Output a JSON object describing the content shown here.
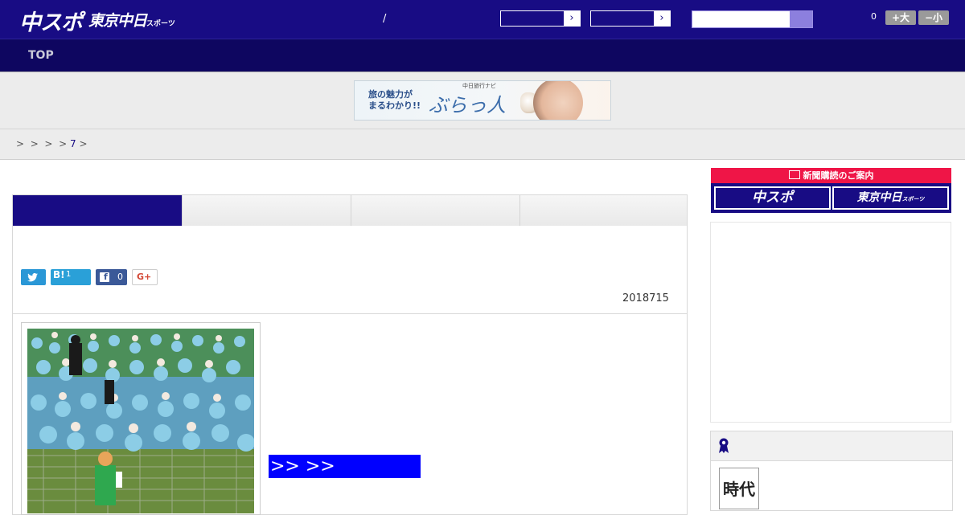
{
  "header": {
    "logo_primary": "中スポ",
    "logo_secondary": "東京中日",
    "logo_secondary_suffix": "スポーツ",
    "divider": "/",
    "counter": "0",
    "font_increase": "+大",
    "font_decrease": "−小",
    "colors": {
      "header_bg": "#180c84",
      "nav_bg": "#0e0660"
    }
  },
  "nav": {
    "items": [
      {
        "label": "TOP"
      }
    ]
  },
  "banner": {
    "headline_line1": "旅の魅力が",
    "headline_line2": "まるわかり!!",
    "brand_caption": "中日旅行ナビ",
    "brand_name": "ぶらっ人"
  },
  "breadcrumb": {
    "separator": ">",
    "items": [
      "",
      "",
      "",
      "",
      "7"
    ]
  },
  "tabs": [
    {
      "label": "",
      "active": true
    },
    {
      "label": "",
      "active": false
    },
    {
      "label": "",
      "active": false
    },
    {
      "label": "",
      "active": false
    }
  ],
  "article": {
    "share": {
      "twitter": "",
      "hatena_label": "B!",
      "hatena_count": "1",
      "facebook_count": "0",
      "google_label": "G+"
    },
    "date": "2018715",
    "more_button": ">> >>"
  },
  "sidebar": {
    "subscription_title": "新聞購読のご案内",
    "subscription_options": [
      "中スポ",
      "東京中日"
    ],
    "subscription_option_suffix": "スポーツ",
    "ranking_thumb_text": "時代"
  },
  "accent_colors": {
    "link": "#180c84",
    "subscribe_red": "#ef1547",
    "button_blue": "#0000ff"
  }
}
